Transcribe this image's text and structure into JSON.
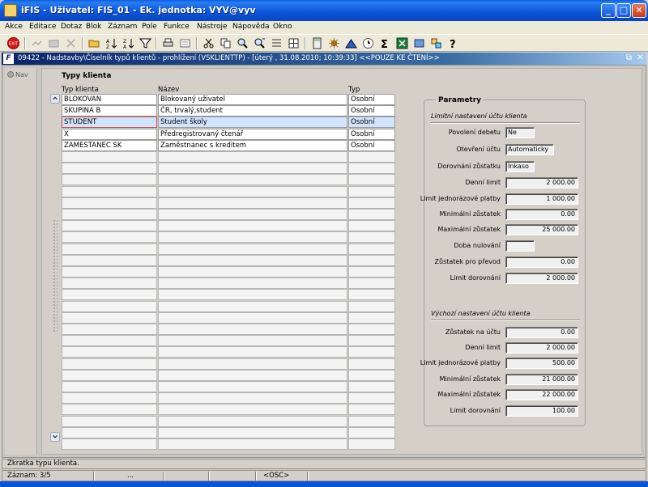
{
  "window": {
    "title": "iFIS - Uživatel: FIS_01 - Ek. jednotka: VYV@vyv",
    "minimize": "_",
    "maximize": "□",
    "close": "✕"
  },
  "menu": [
    "Akce",
    "Editace",
    "Dotaz",
    "Blok",
    "Záznam",
    "Pole",
    "Funkce",
    "Nástroje",
    "Nápověda",
    "Okno"
  ],
  "toolbar_icons": [
    "exit-icon",
    "save-icon",
    "print-preview-icon",
    "delete-icon",
    "open-folder-icon",
    "sort-asc-icon",
    "sort-desc-icon",
    "filter-icon",
    "printer-icon",
    "print-setup-icon",
    "cut-icon",
    "copy-icon",
    "find-icon",
    "find-replace-icon",
    "insert-row-icon",
    "split-icon",
    "calculator-icon",
    "settings-icon",
    "chart-icon",
    "clock-icon",
    "sigma-icon",
    "excel-icon",
    "export-icon",
    "links-icon",
    "help-icon"
  ],
  "form": {
    "window_title": "09422 - Nadstavby\\Číselník typů klientů - prohlížení (VSKLIENTTP) - [úterý , 31.08.2010; 10:39:33] <<POUZE KE ČTENÍ>>",
    "restore": "⧉",
    "close": "✕",
    "nav_label": "Nav",
    "group_label": "Typy klienta",
    "columns": [
      "Typ klienta",
      "Název",
      "Typ"
    ],
    "rows": [
      {
        "code": "BLOKOVAN",
        "name": "Blokovaný uživatel",
        "type": "Osobní"
      },
      {
        "code": "SKUPINA B",
        "name": "ČR, trvalý,student",
        "type": "Osobní"
      },
      {
        "code": "STUDENT",
        "name": "Student školy",
        "type": "Osobní"
      },
      {
        "code": "X",
        "name": "Předregistrovaný čtenář",
        "type": "Osobní"
      },
      {
        "code": "ZAMESTANEC SK",
        "name": "Zaměstnanec s kreditem",
        "type": "Osobní"
      }
    ],
    "selected_row": 2,
    "empty_rows": 26
  },
  "params": {
    "title": "Parametry",
    "limit_section": "Limitní nastavení účtu klienta",
    "default_section": "Výchozí nastavení účtu klienta",
    "limit_fields": [
      {
        "label": "Povolení debetu",
        "value": "Ne"
      },
      {
        "label": "Otevření účtu",
        "value": "Automaticky"
      },
      {
        "label": "Dorovnání zůstatku",
        "value": "Inkaso"
      },
      {
        "label": "Denní limit",
        "value": "2 000.00"
      },
      {
        "label": "Limit jednorázové platby",
        "value": "1 000.00"
      },
      {
        "label": "Minimální zůstatek",
        "value": "0.00"
      },
      {
        "label": "Maximální zůstatek",
        "value": "25 000.00"
      },
      {
        "label": "Doba nulování",
        "value": ""
      },
      {
        "label": "Zůstatek pro převod",
        "value": "0.00"
      },
      {
        "label": "Limit dorovnání",
        "value": "2 000.00"
      }
    ],
    "default_fields": [
      {
        "label": "Zůstatek na účtu",
        "value": "0.00"
      },
      {
        "label": "Denní limit",
        "value": "2 000.00"
      },
      {
        "label": "Limit jednorázové platby",
        "value": "500.00"
      },
      {
        "label": "Minimální zůstatek",
        "value": "21 000.00"
      },
      {
        "label": "Maximální zůstatek",
        "value": "22 000.00"
      },
      {
        "label": "Limit dorovnání",
        "value": "100.00"
      }
    ]
  },
  "status": {
    "hint": "Zkratka typu klienta.",
    "record": "Záznam: 3/5",
    "seg2": "...",
    "mode": "<OSC>"
  }
}
